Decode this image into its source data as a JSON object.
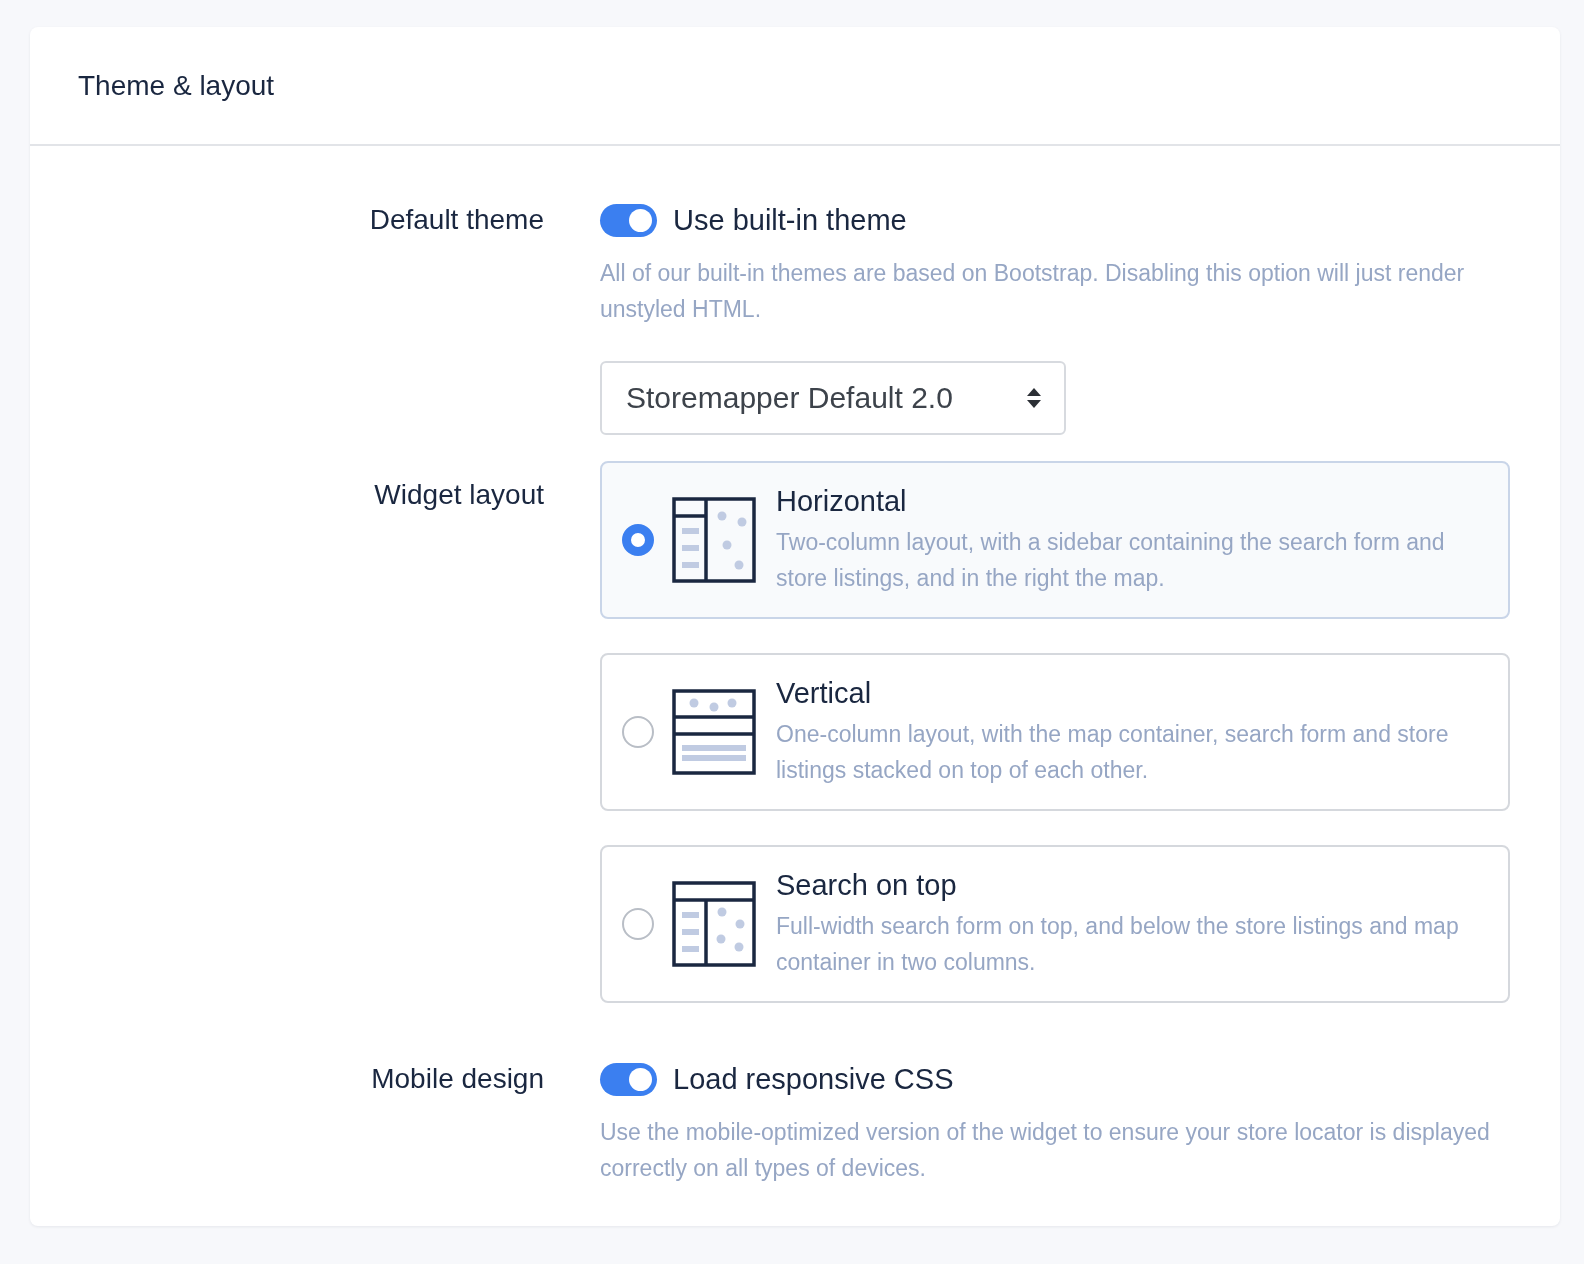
{
  "panel": {
    "title": "Theme & layout"
  },
  "sections": [
    {
      "kind": "toggle",
      "label": "Default theme",
      "toggle": {
        "label": "Use built-in theme",
        "on": true
      },
      "hint": "All of our built-in themes are based on Bootstrap. Disabling this option will just render unstyled HTML.",
      "select": {
        "value": "Storemapper Default 2.0"
      }
    },
    {
      "kind": "layouts",
      "label": "Widget layout",
      "options": [
        {
          "kind": "horizontal",
          "title": "Horizontal",
          "description": "Two-column layout, with a sidebar containing the search form and store listings, and in the right the map.",
          "selected": true
        },
        {
          "kind": "vertical",
          "title": "Vertical",
          "description": "One-column layout, with the map container, search form and store listings stacked on top of each other.",
          "selected": false
        },
        {
          "kind": "search_top",
          "title": "Search on top",
          "description": "Full-width search form on top, and below the store listings and map container in two columns.",
          "selected": false
        }
      ]
    },
    {
      "kind": "toggle",
      "label": "Mobile design",
      "toggle": {
        "label": "Load responsive CSS",
        "on": true
      },
      "hint": "Use the mobile-optimized version of the widget to ensure your store locator is displayed correctly on all types of devices."
    }
  ]
}
